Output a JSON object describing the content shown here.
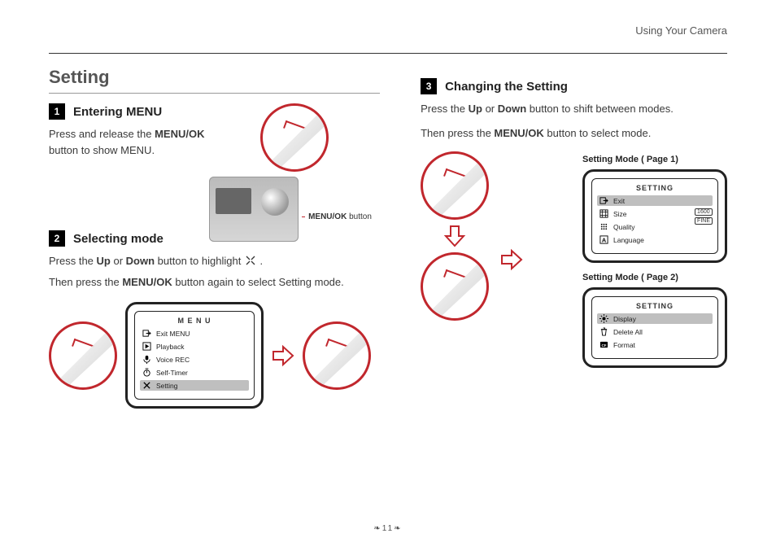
{
  "header": {
    "section_label": "Using Your Camera"
  },
  "page_number": "11",
  "left": {
    "section_title": "Setting",
    "step1": {
      "num": "1",
      "heading": "Entering MENU",
      "line1a": "Press and release the ",
      "line1_bold": "MENU/OK",
      "line1b": " button to show MENU.",
      "button_label_bold": "MENU/OK",
      "button_label_rest": " button"
    },
    "step2": {
      "num": "2",
      "heading": "Selecting mode",
      "line1a": "Press the ",
      "line1_bold1": "Up",
      "line1b": " or ",
      "line1_bold2": "Down",
      "line1c": " button to highlight ",
      "line1d": " .",
      "line2a": "Then press the ",
      "line2_bold": "MENU/OK",
      "line2b": " button again to select Setting mode."
    },
    "menu_screen": {
      "title": "M E N U",
      "items": [
        {
          "icon": "exit",
          "label": "Exit MENU"
        },
        {
          "icon": "play",
          "label": "Playback"
        },
        {
          "icon": "mic",
          "label": "Voice REC"
        },
        {
          "icon": "timer",
          "label": "Self-Timer"
        },
        {
          "icon": "tools",
          "label": "Setting",
          "highlight": true
        }
      ]
    }
  },
  "right": {
    "step3": {
      "num": "3",
      "heading": "Changing the Setting",
      "line1a": "Press the ",
      "line1_bold1": "Up",
      "line1b": " or ",
      "line1_bold2": "Down",
      "line1c": " button to shift between modes.",
      "line2a": "Then press the ",
      "line2_bold": "MENU/OK",
      "line2b": " button to select mode."
    },
    "page1": {
      "caption": "Setting Mode ( Page 1)",
      "title": "SETTING",
      "items": [
        {
          "icon": "exit",
          "label": "Exit",
          "highlight": true
        },
        {
          "icon": "grid",
          "label": "Size"
        },
        {
          "icon": "dots",
          "label": "Quality"
        },
        {
          "icon": "A",
          "label": "Language"
        }
      ],
      "side_codes": [
        "1600",
        "FINE"
      ]
    },
    "page2": {
      "caption": "Setting Mode ( Page 2)",
      "title": "SETTING",
      "items": [
        {
          "icon": "bright",
          "label": "Display",
          "highlight": true
        },
        {
          "icon": "trash",
          "label": "Delete All"
        },
        {
          "icon": "cf",
          "label": "Format"
        }
      ]
    }
  }
}
